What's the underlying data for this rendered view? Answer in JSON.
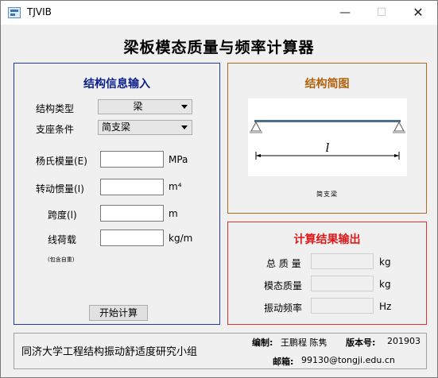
{
  "window": {
    "title": "TJVIB"
  },
  "app_title": "梁板模态质量与频率计算器",
  "input_panel": {
    "title": "结构信息输入",
    "structure_type": {
      "label": "结构类型",
      "value": "梁"
    },
    "support": {
      "label": "支座条件",
      "value": "简支梁"
    },
    "youngs_modulus": {
      "label": "杨氏模量(E)",
      "value": "",
      "unit": "MPa"
    },
    "moment_inertia": {
      "label": "转动惯量(I)",
      "value": "",
      "unit": "m⁴"
    },
    "span": {
      "label": "跨度(l)",
      "value": "",
      "unit": "m"
    },
    "line_load": {
      "label": "线荷载",
      "value": "",
      "unit": "kg/m",
      "note": "(包含自重)"
    },
    "compute_button": "开始计算"
  },
  "diagram_panel": {
    "title": "结构简图",
    "span_symbol": "l",
    "caption": "简支梁"
  },
  "output_panel": {
    "title": "计算结果输出",
    "total_mass": {
      "label": "总 质 量",
      "value": "",
      "unit": "kg"
    },
    "modal_mass": {
      "label": "模态质量",
      "value": "",
      "unit": "kg"
    },
    "frequency": {
      "label": "振动频率",
      "value": "",
      "unit": "Hz"
    }
  },
  "footer": {
    "group": "同济大学工程结构振动舒适度研究小组",
    "author_label": "编制:",
    "authors": "王鹏程 陈隽",
    "version_label": "版本号:",
    "version": "201903",
    "email_label": "邮箱:",
    "email": "99130@tongji.edu.cn"
  }
}
